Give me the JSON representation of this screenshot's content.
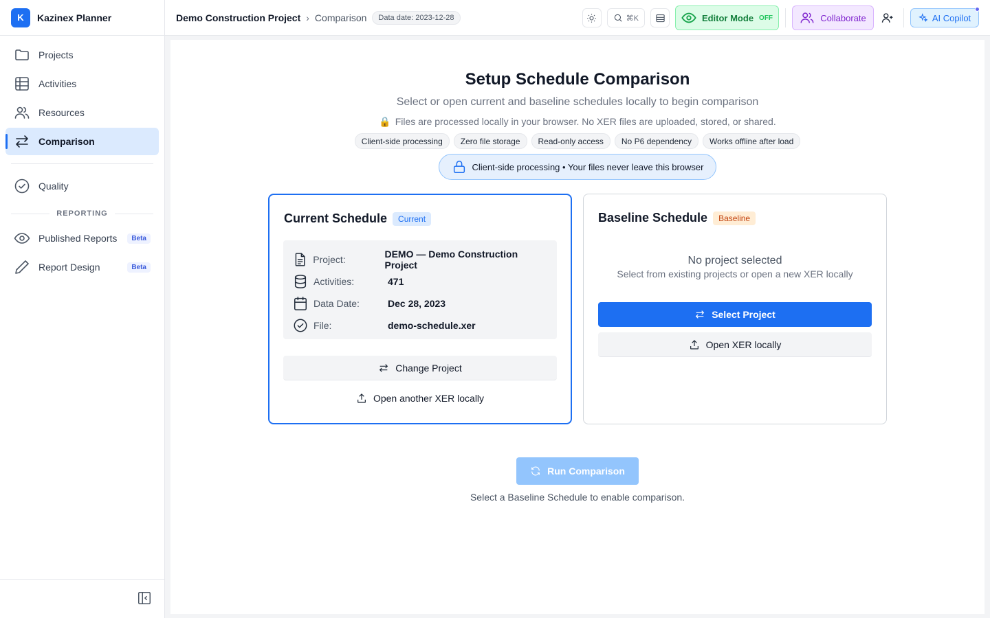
{
  "app": {
    "logo_letter": "K",
    "name": "Kazinex Planner"
  },
  "sidebar": {
    "items": [
      {
        "label": "Projects",
        "icon": "folder-icon"
      },
      {
        "label": "Activities",
        "icon": "grid-icon"
      },
      {
        "label": "Resources",
        "icon": "users-icon"
      },
      {
        "label": "Comparison",
        "icon": "swap-icon",
        "active": true
      },
      {
        "label": "Quality",
        "icon": "check-circle-icon"
      }
    ],
    "reporting_heading": "REPORTING",
    "reporting_items": [
      {
        "label": "Published Reports",
        "badge": "Beta",
        "icon": "eye-icon"
      },
      {
        "label": "Report Design",
        "badge": "Beta",
        "icon": "pencil-icon"
      }
    ]
  },
  "header": {
    "breadcrumb_project": "Demo Construction Project",
    "breadcrumb_sep": "›",
    "breadcrumb_page": "Comparison",
    "data_date": "Data date: 2023-12-28",
    "search_shortcut": "⌘K",
    "editor_mode_label": "Editor Mode",
    "editor_mode_state": "OFF",
    "collaborate_label": "Collaborate",
    "copilot_label": "AI Copilot"
  },
  "main": {
    "title": "Setup Schedule Comparison",
    "subtitle": "Select or open current and baseline schedules locally to begin comparison",
    "privacy_icon": "🔒",
    "privacy_note": "Files are processed locally in your browser. No XER files are uploaded, stored, or shared.",
    "chips": [
      "Client-side processing",
      "Zero file storage",
      "Read-only access",
      "No P6 dependency",
      "Works offline after load"
    ],
    "banner": "Client-side processing • Your files never leave this browser",
    "current": {
      "title": "Current Schedule",
      "tag": "Current",
      "rows": [
        {
          "label": "Project:",
          "value": "DEMO — Demo Construction Project"
        },
        {
          "label": "Activities:",
          "value": "471"
        },
        {
          "label": "Data Date:",
          "value": "Dec 28, 2023"
        },
        {
          "label": "File:",
          "value": "demo-schedule.xer"
        }
      ],
      "change_label": "Change Project",
      "open_label": "Open another XER locally"
    },
    "baseline": {
      "title": "Baseline Schedule",
      "tag": "Baseline",
      "empty_title": "No project selected",
      "empty_sub": "Select from existing projects or open a new XER locally",
      "select_label": "Select Project",
      "open_label": "Open XER locally"
    },
    "run_label": "Run Comparison",
    "run_hint": "Select a Baseline Schedule to enable comparison."
  },
  "colors": {
    "accent": "#1d6ff2",
    "editor_green": "#15803d",
    "collab_purple": "#7e22ce",
    "baseline_orange": "#c2410c"
  }
}
